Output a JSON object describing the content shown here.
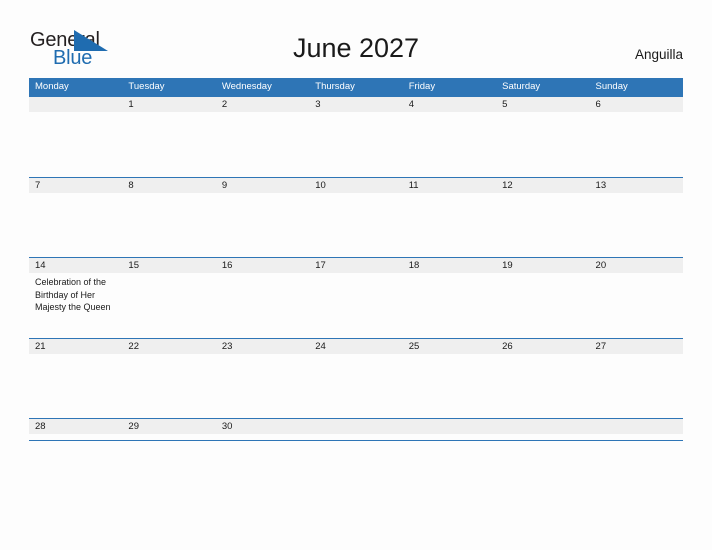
{
  "brand": {
    "name_part1": "General",
    "name_part2": "Blue",
    "flag_icon": "flag-triangle-icon",
    "colors": {
      "text_dark": "#231f20",
      "blue": "#1f6cb0"
    }
  },
  "header": {
    "title": "June 2027",
    "country": "Anguilla"
  },
  "theme": {
    "header_blue": "#2e75b6",
    "date_band_gray": "#efefef",
    "page_background": "#fdfdfd",
    "text_color": "#1a1a1a"
  },
  "calendar": {
    "weekdays": [
      "Monday",
      "Tuesday",
      "Wednesday",
      "Thursday",
      "Friday",
      "Saturday",
      "Sunday"
    ],
    "weeks": [
      {
        "dates": [
          "",
          "1",
          "2",
          "3",
          "4",
          "5",
          "6"
        ],
        "events": [
          "",
          "",
          "",
          "",
          "",
          "",
          ""
        ]
      },
      {
        "dates": [
          "7",
          "8",
          "9",
          "10",
          "11",
          "12",
          "13"
        ],
        "events": [
          "",
          "",
          "",
          "",
          "",
          "",
          ""
        ]
      },
      {
        "dates": [
          "14",
          "15",
          "16",
          "17",
          "18",
          "19",
          "20"
        ],
        "events": [
          "Celebration of the Birthday of Her Majesty the Queen",
          "",
          "",
          "",
          "",
          "",
          ""
        ]
      },
      {
        "dates": [
          "21",
          "22",
          "23",
          "24",
          "25",
          "26",
          "27"
        ],
        "events": [
          "",
          "",
          "",
          "",
          "",
          "",
          ""
        ]
      },
      {
        "dates": [
          "28",
          "29",
          "30",
          "",
          "",
          "",
          ""
        ],
        "events": [
          "",
          "",
          "",
          "",
          "",
          "",
          ""
        ]
      }
    ]
  }
}
